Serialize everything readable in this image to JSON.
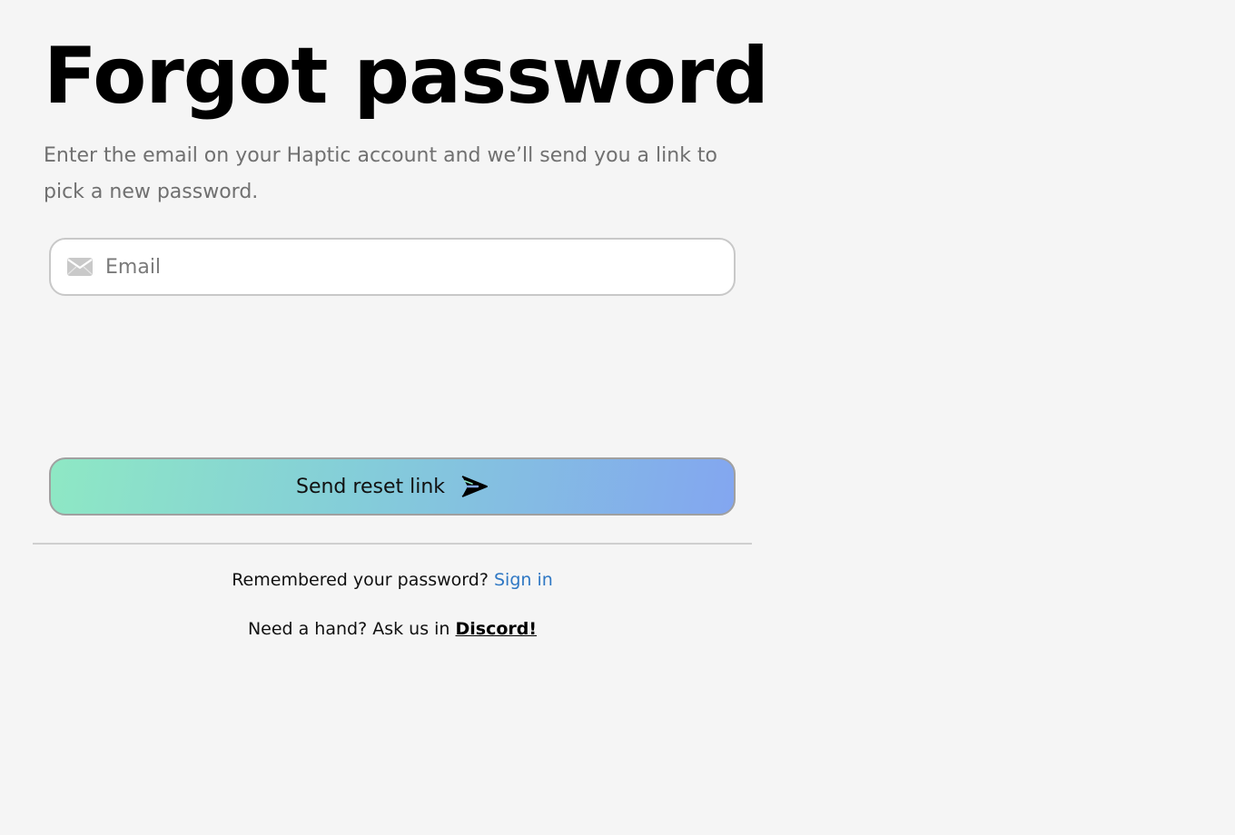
{
  "page": {
    "title": "Forgot password",
    "subtitle": "Enter the email on your Haptic account and we’ll send you a link to pick a new password."
  },
  "form": {
    "email": {
      "icon": "mail-icon",
      "placeholder": "Email",
      "value": ""
    },
    "submit": {
      "label": "Send reset link",
      "icon": "send-arrow-icon",
      "gradient": [
        "#8ee8c4",
        "#83a6f0"
      ]
    }
  },
  "footer": {
    "remembered_text": "Remembered your password?",
    "signin_label": "Sign in",
    "help_text": "Need a hand? Ask us in",
    "discord_label": "Discord!",
    "link_color": "#2f78c4"
  }
}
